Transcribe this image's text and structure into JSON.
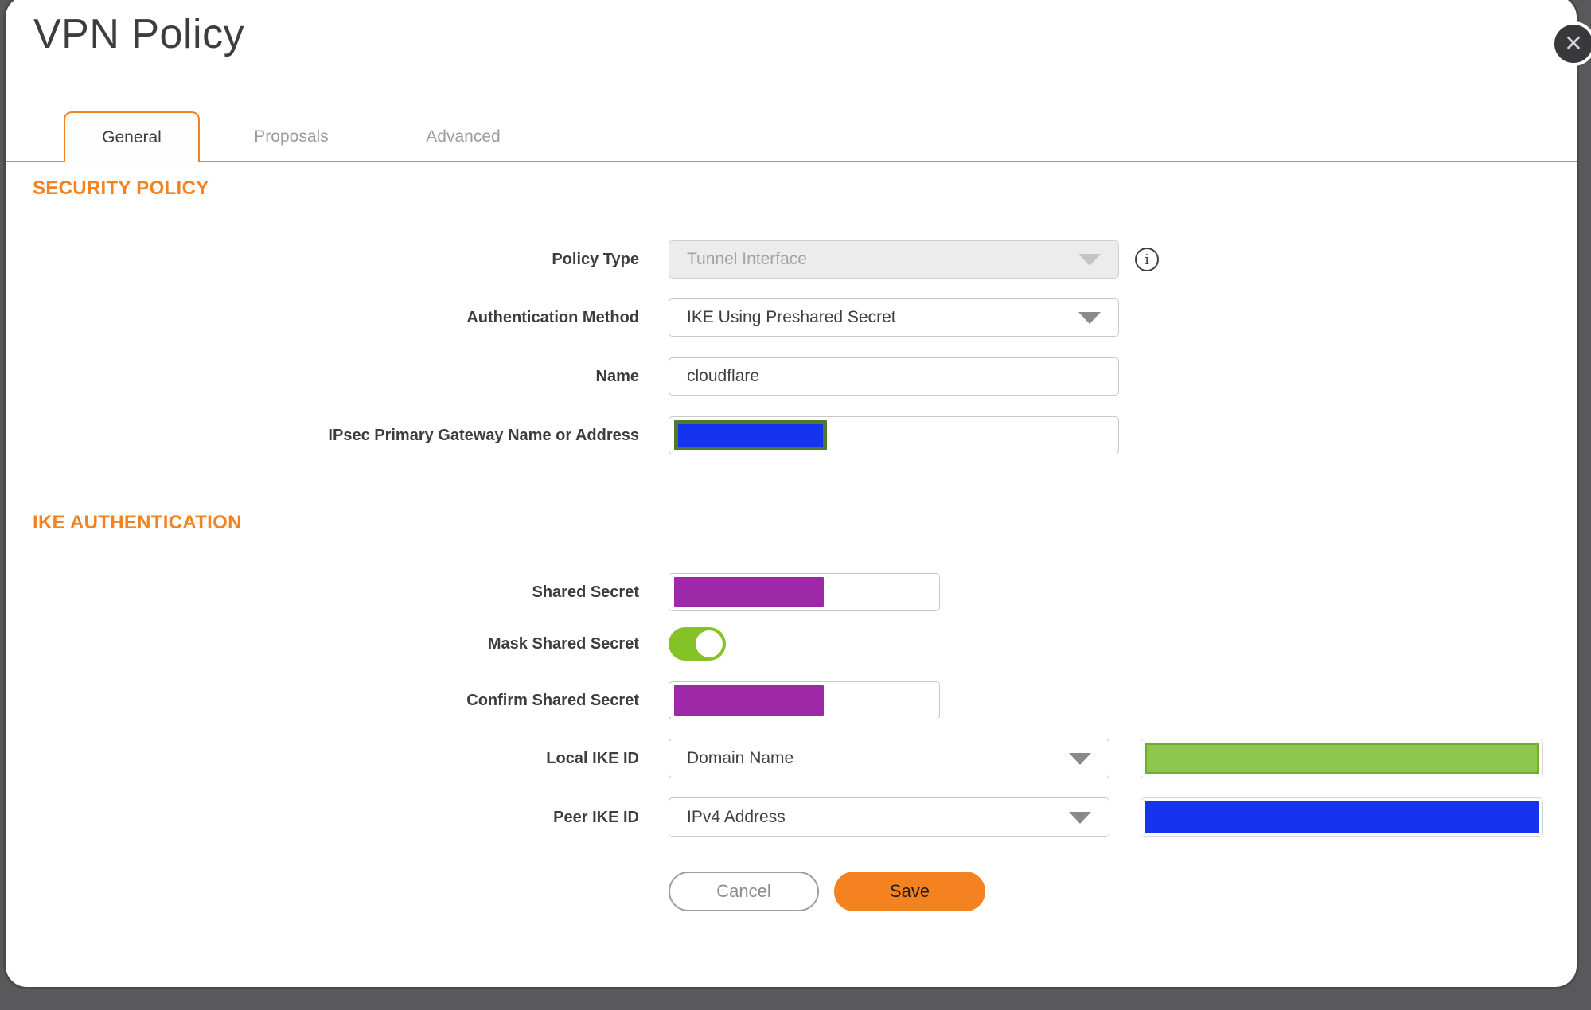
{
  "dialog": {
    "title": "VPN Policy",
    "close_glyph": "✕"
  },
  "tabs": [
    {
      "label": "General",
      "active": true
    },
    {
      "label": "Proposals",
      "active": false
    },
    {
      "label": "Advanced",
      "active": false
    }
  ],
  "sections": {
    "security_policy": {
      "heading": "SECURITY POLICY"
    },
    "ike_authentication": {
      "heading": "IKE AUTHENTICATION"
    }
  },
  "fields": {
    "policy_type": {
      "label": "Policy Type",
      "value": "Tunnel Interface",
      "disabled": true
    },
    "authentication_method": {
      "label": "Authentication Method",
      "value": "IKE Using Preshared Secret"
    },
    "name": {
      "label": "Name",
      "value": "cloudflare"
    },
    "ipsec_primary_gateway": {
      "label": "IPsec Primary Gateway Name or Address",
      "value_redacted": true
    },
    "shared_secret": {
      "label": "Shared Secret",
      "value_redacted": true
    },
    "mask_shared_secret": {
      "label": "Mask Shared Secret",
      "state": "on"
    },
    "confirm_shared_secret": {
      "label": "Confirm Shared Secret",
      "value_redacted": true
    },
    "local_ike_id": {
      "label": "Local IKE ID",
      "type_value": "Domain Name",
      "value_redacted": true
    },
    "peer_ike_id": {
      "label": "Peer IKE ID",
      "type_value": "IPv4 Address",
      "value_redacted": true
    }
  },
  "buttons": {
    "cancel": "Cancel",
    "save": "Save"
  },
  "icons": {
    "info_glyph": "i"
  },
  "colors": {
    "accent_orange": "#F58220",
    "toggle_green": "#85C226",
    "redaction_purple": "#9D28A8",
    "redaction_blue": "#1633F0",
    "redaction_green_fill": "#8DC74D",
    "redaction_green_border": "#72AB2F",
    "ipsec_redaction_border": "#4D7A2C",
    "backdrop_gray": "#59595B"
  }
}
